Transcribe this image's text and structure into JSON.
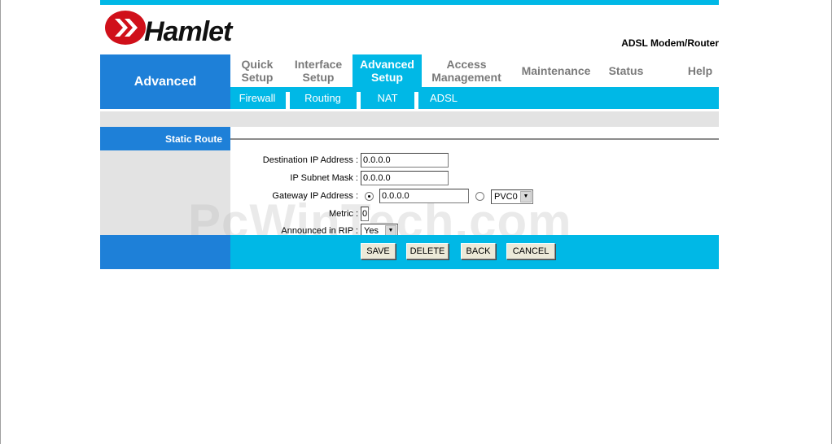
{
  "header": {
    "brand": "Hamlet",
    "model": "ADSL Modem/Router"
  },
  "nav": {
    "section_title": "Advanced",
    "tabs": [
      {
        "line1": "Quick",
        "line2": "Setup"
      },
      {
        "line1": "Interface",
        "line2": "Setup"
      },
      {
        "line1": "Advanced",
        "line2": "Setup"
      },
      {
        "line1": "Access",
        "line2": "Management"
      },
      {
        "line1": "Maintenance",
        "line2": ""
      },
      {
        "line1": "Status",
        "line2": ""
      },
      {
        "line1": "Help",
        "line2": ""
      }
    ],
    "subtabs": [
      "Firewall",
      "Routing",
      "NAT",
      "ADSL"
    ]
  },
  "section": {
    "title": "Static Route"
  },
  "form": {
    "dest_ip_label": "Destination IP Address :",
    "dest_ip_value": "0.0.0.0",
    "subnet_label": "IP Subnet Mask :",
    "subnet_value": "0.0.0.0",
    "gateway_label": "Gateway IP Address :",
    "gateway_value": "0.0.0.0",
    "gateway_mode": "ip",
    "pvc_value": "PVC0",
    "metric_label": "Metric :",
    "metric_value": "0",
    "rip_label": "Announced in RIP :",
    "rip_value": "Yes"
  },
  "buttons": {
    "save": "SAVE",
    "delete": "DELETE",
    "back": "BACK",
    "cancel": "CANCEL"
  },
  "watermark": "PcWinTech.com",
  "colors": {
    "primary_blue": "#1e80d8",
    "cyan": "#00b8e6",
    "panel_gray": "#e3e3e3",
    "logo_red": "#d0101a"
  }
}
